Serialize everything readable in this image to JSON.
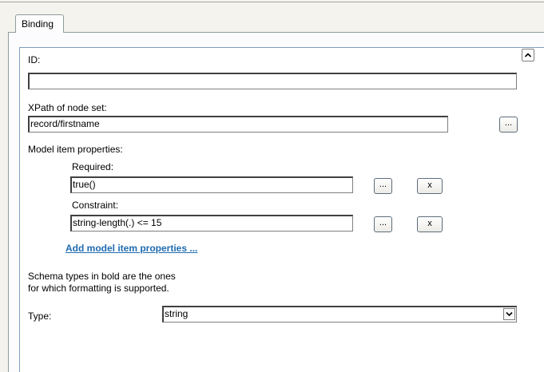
{
  "tabs": [
    {
      "label": "Binding"
    }
  ],
  "form": {
    "id_label": "ID:",
    "id_value": "",
    "xpath_label": "XPath of node set:",
    "xpath_value": "record/firstname",
    "model_props_label": "Model item properties:",
    "required_label": "Required:",
    "required_value": "true()",
    "constraint_label": "Constraint:",
    "constraint_value": "string-length(.) <= 15",
    "browse_label": "...",
    "remove_label": "x",
    "add_link": "Add model item properties ...",
    "schema_note_line1": "Schema types in bold are the ones",
    "schema_note_line2": "for which formatting is supported.",
    "type_label": "Type:",
    "type_value": "string"
  },
  "icons": {
    "scroll_up": "chevron-up-icon",
    "dropdown": "chevron-down-icon"
  },
  "colors": {
    "link": "#1f6bb0",
    "field_border": "#404040",
    "tab_border": "#919b9c"
  }
}
